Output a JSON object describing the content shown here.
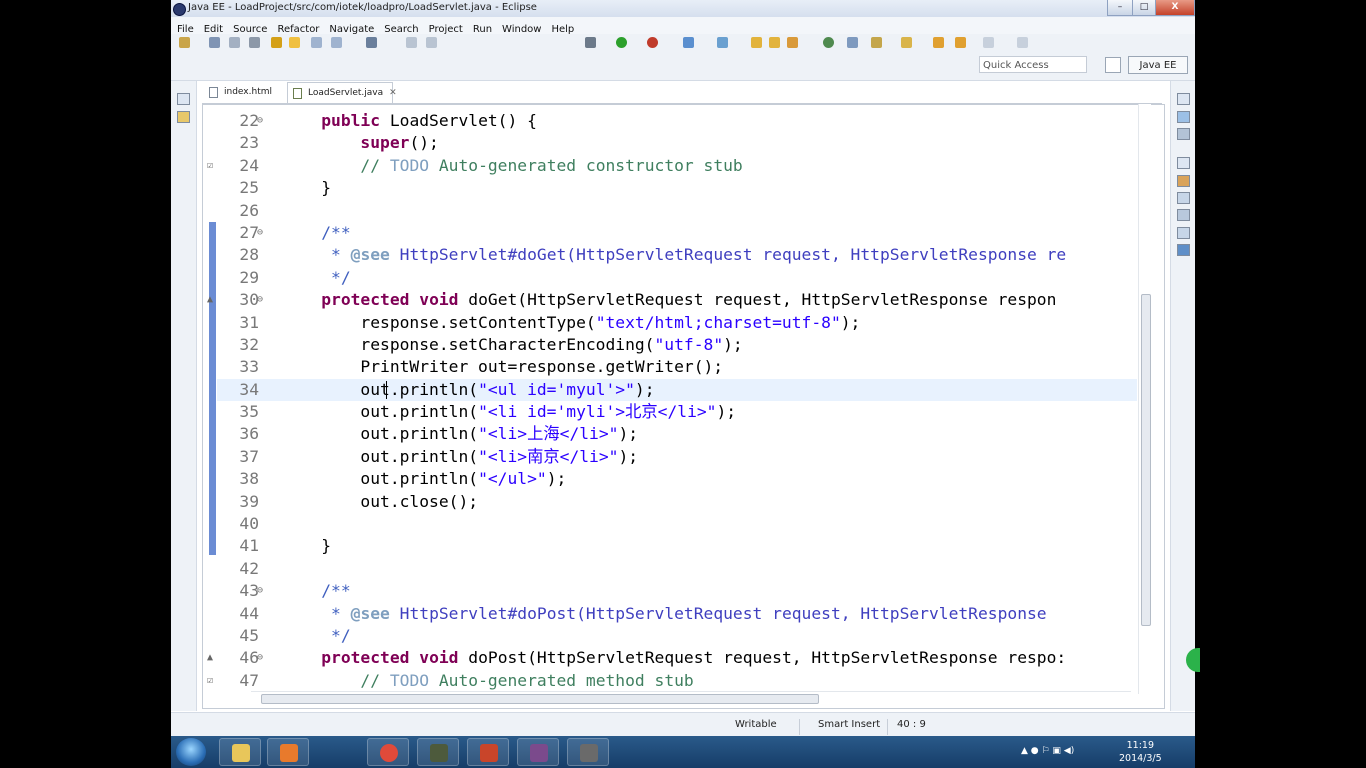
{
  "window": {
    "title": "Java EE - LoadProject/src/com/iotek/loadpro/LoadServlet.java - Eclipse",
    "min": "–",
    "max": "□",
    "close": "X"
  },
  "menu": [
    "File",
    "Edit",
    "Source",
    "Refactor",
    "Navigate",
    "Search",
    "Project",
    "Run",
    "Window",
    "Help"
  ],
  "quick_access": "Quick Access",
  "perspective": "Java EE",
  "tabs": [
    {
      "label": "index.html",
      "active": false
    },
    {
      "label": "LoadServlet.java",
      "active": true,
      "close": "✕"
    }
  ],
  "editor_lines": [
    {
      "n": "22",
      "fold": "⊖"
    },
    {
      "n": "23"
    },
    {
      "n": "24",
      "marker": "☑"
    },
    {
      "n": "25"
    },
    {
      "n": "26"
    },
    {
      "n": "27",
      "fold": "⊖"
    },
    {
      "n": "28"
    },
    {
      "n": "29"
    },
    {
      "n": "30",
      "fold": "⊖",
      "marker": "▲"
    },
    {
      "n": "31"
    },
    {
      "n": "32"
    },
    {
      "n": "33"
    },
    {
      "n": "34"
    },
    {
      "n": "35"
    },
    {
      "n": "36"
    },
    {
      "n": "37"
    },
    {
      "n": "38"
    },
    {
      "n": "39"
    },
    {
      "n": "40"
    },
    {
      "n": "41"
    },
    {
      "n": "42"
    },
    {
      "n": "43",
      "fold": "⊖"
    },
    {
      "n": "44"
    },
    {
      "n": "45"
    },
    {
      "n": "46",
      "fold": "⊖",
      "marker": "▲"
    },
    {
      "n": "47",
      "marker": "☑"
    }
  ],
  "code": {
    "l22": {
      "kw": "public",
      "rest": " LoadServlet() {"
    },
    "l23": {
      "kw": "super",
      "rest": "();"
    },
    "l24": {
      "c1": "// ",
      "todo": "TODO",
      "c2": " Auto-generated constructor stub"
    },
    "l25": "}",
    "l27": "/**",
    "l28": {
      "star": " * ",
      "tag": "@see",
      "link": " HttpServlet#doGet(HttpServletRequest request, HttpServletResponse re"
    },
    "l29": " */",
    "l30": {
      "kw1": "protected",
      "kw2": "void",
      "rest": " doGet(HttpServletRequest request, HttpServletResponse respon"
    },
    "l31": {
      "pre": "response.setContentType(",
      "str": "\"text/html;charset=utf-8\"",
      "post": ");"
    },
    "l32": {
      "pre": "response.setCharacterEncoding(",
      "str": "\"utf-8\"",
      "post": ");"
    },
    "l33": "PrintWriter out=response.getWriter();",
    "l34": {
      "pre": "out.println(",
      "str": "\"<ul id='myul'>\"",
      "post": ");"
    },
    "l35": {
      "pre": "out.println(",
      "str": "\"<li id='myli'>北京</li>\"",
      "post": ");"
    },
    "l36": {
      "pre": "out.println(",
      "str": "\"<li>上海</li>\"",
      "post": ");"
    },
    "l37": {
      "pre": "out.println(",
      "str": "\"<li>南京</li>\"",
      "post": ");"
    },
    "l38": {
      "pre": "out.println(",
      "str": "\"</ul>\"",
      "post": ");"
    },
    "l39": "out.close();",
    "l41": "}",
    "l43": "/**",
    "l44": {
      "star": " * ",
      "tag": "@see",
      "link": " HttpServlet#doPost(HttpServletRequest request, HttpServletResponse"
    },
    "l45": " */",
    "l46": {
      "kw1": "protected",
      "kw2": "void",
      "rest": " doPost(HttpServletRequest request, HttpServletResponse respo:"
    },
    "l47": {
      "c1": "// ",
      "todo": "TODO",
      "c2": " Auto-generated method stub"
    }
  },
  "status": {
    "writable": "Writable",
    "insert": "Smart Insert",
    "position": "40 : 9"
  },
  "clock": {
    "time": "11:19",
    "date": "2014/3/5"
  },
  "colors": {
    "keyword": "#7f0055",
    "string": "#2a00ff",
    "comment": "#3f7f5f",
    "javadoc": "#3f5fbf"
  }
}
